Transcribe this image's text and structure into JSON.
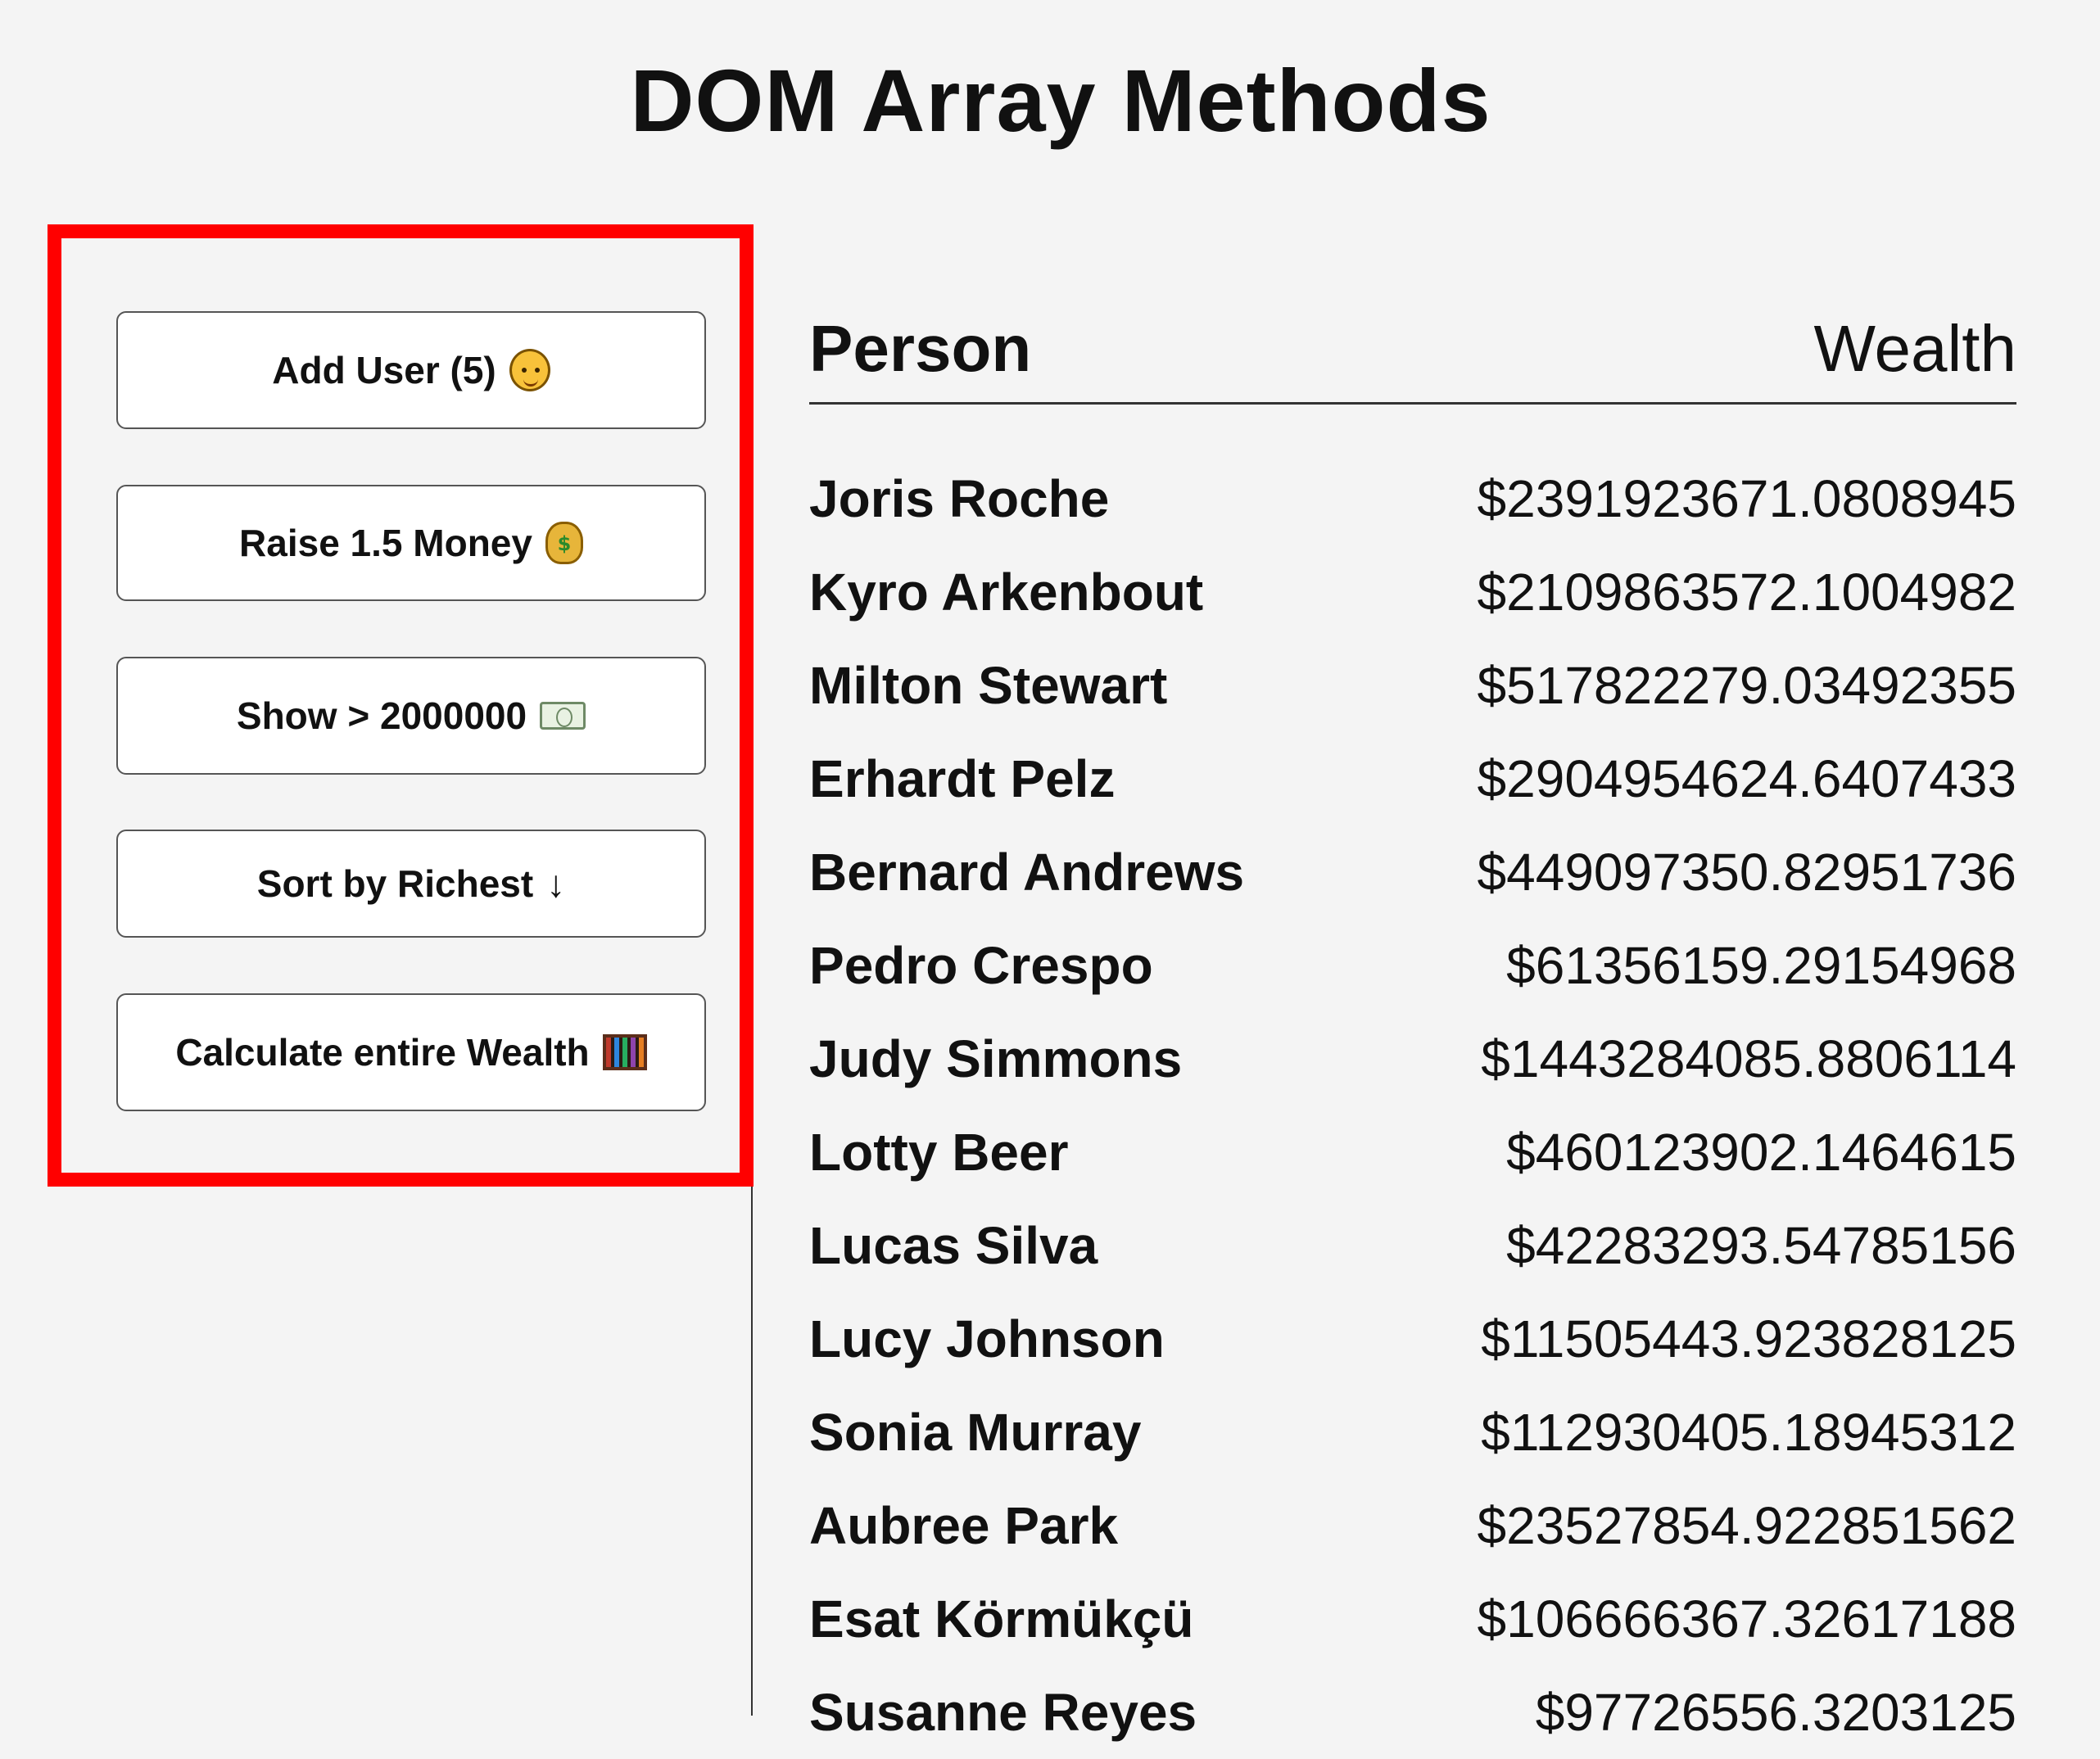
{
  "page": {
    "title": "DOM Array Methods"
  },
  "sidebar": {
    "highlight_color": "#ff0000",
    "buttons": [
      {
        "label": "Add User (5)",
        "icon": "person-face-icon"
      },
      {
        "label": "Raise 1.5 Money",
        "icon": "money-bag-icon"
      },
      {
        "label": "Show > 2000000",
        "icon": "banknote-icon"
      },
      {
        "label": "Sort by Richest",
        "icon": "arrow-down-icon",
        "glyph": "↓"
      },
      {
        "label": "Calculate entire Wealth",
        "icon": "abacus-icon"
      }
    ]
  },
  "table": {
    "header": {
      "person": "Person",
      "wealth": "Wealth"
    },
    "rows": [
      {
        "name": "Joris Roche",
        "wealth": "$2391923671.0808945"
      },
      {
        "name": "Kyro Arkenbout",
        "wealth": "$2109863572.1004982"
      },
      {
        "name": "Milton Stewart",
        "wealth": "$517822279.03492355"
      },
      {
        "name": "Erhardt Pelz",
        "wealth": "$2904954624.6407433"
      },
      {
        "name": "Bernard Andrews",
        "wealth": "$449097350.82951736"
      },
      {
        "name": "Pedro Crespo",
        "wealth": "$61356159.29154968"
      },
      {
        "name": "Judy Simmons",
        "wealth": "$1443284085.8806114"
      },
      {
        "name": "Lotty Beer",
        "wealth": "$460123902.1464615"
      },
      {
        "name": "Lucas Silva",
        "wealth": "$42283293.54785156"
      },
      {
        "name": "Lucy Johnson",
        "wealth": "$11505443.923828125"
      },
      {
        "name": "Sonia Murray",
        "wealth": "$112930405.18945312"
      },
      {
        "name": "Aubree Park",
        "wealth": "$23527854.922851562"
      },
      {
        "name": "Esat Körmükçü",
        "wealth": "$106666367.32617188"
      },
      {
        "name": "Susanne Reyes",
        "wealth": "$97726556.3203125"
      }
    ]
  }
}
